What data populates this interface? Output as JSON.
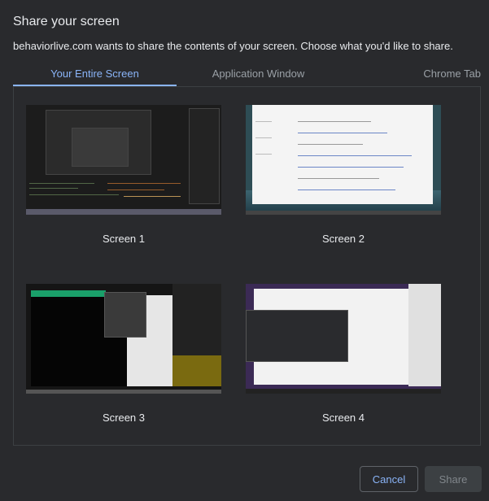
{
  "dialog": {
    "title": "Share your screen",
    "subtitle": "behaviorlive.com wants to share the contents of your screen. Choose what you'd like to share."
  },
  "tabs": [
    {
      "label": "Your Entire Screen",
      "active": true
    },
    {
      "label": "Application Window",
      "active": false
    },
    {
      "label": "Chrome Tab",
      "active": false
    }
  ],
  "screens": [
    {
      "label": "Screen 1"
    },
    {
      "label": "Screen 2"
    },
    {
      "label": "Screen 3"
    },
    {
      "label": "Screen 4"
    }
  ],
  "buttons": {
    "cancel": "Cancel",
    "share": "Share"
  },
  "colors": {
    "accent": "#8ab4f8",
    "background": "#292a2d",
    "text": "#e8eaed",
    "muted": "#9aa0a6"
  }
}
